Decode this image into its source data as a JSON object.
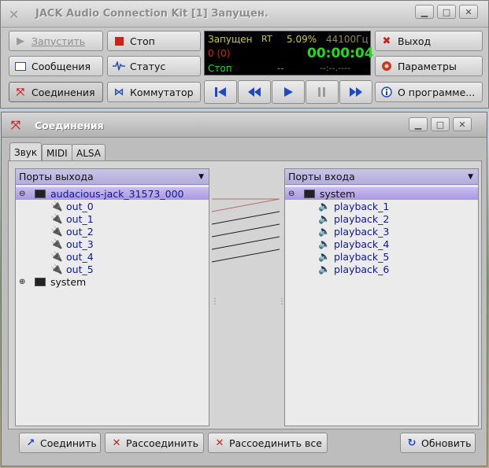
{
  "jack": {
    "title": "JACK Audio Connection Kit [1] Запущен.",
    "buttons": {
      "start": "Запустить",
      "stop": "Стоп",
      "messages": "Сообщения",
      "status": "Статус",
      "connections": "Соединения",
      "patchbay": "Коммутатор",
      "quit": "Выход",
      "setup": "Параметры",
      "about": "О программе..."
    },
    "display": {
      "state": "Запущен",
      "rt": "RT",
      "dsp": "5.09%",
      "rate": "44100Гц",
      "xruns": "0 (0)",
      "time": "00:00:04",
      "transport_state": "Стоп",
      "bpm": "--",
      "bbt": "--:--.----"
    },
    "colors": {
      "display_green": "#1edc1e",
      "display_yellow": "#d0d000",
      "display_red": "#e01e1e"
    }
  },
  "connections": {
    "title": "Соединения",
    "tabs": [
      "Звук",
      "MIDI",
      "ALSA"
    ],
    "output_header": "Порты выхода",
    "input_header": "Порты входа",
    "outputs": {
      "client": "audacious-jack_31573_000",
      "ports": [
        "out_0",
        "out_1",
        "out_2",
        "out_3",
        "out_4",
        "out_5"
      ],
      "other_client": "system"
    },
    "inputs": {
      "client": "system",
      "ports": [
        "playback_1",
        "playback_2",
        "playback_3",
        "playback_4",
        "playback_5",
        "playback_6"
      ]
    },
    "buttons": {
      "connect": "Соединить",
      "disconnect": "Рассоединить",
      "disconnect_all": "Рассоединить все",
      "refresh": "Обновить"
    }
  }
}
